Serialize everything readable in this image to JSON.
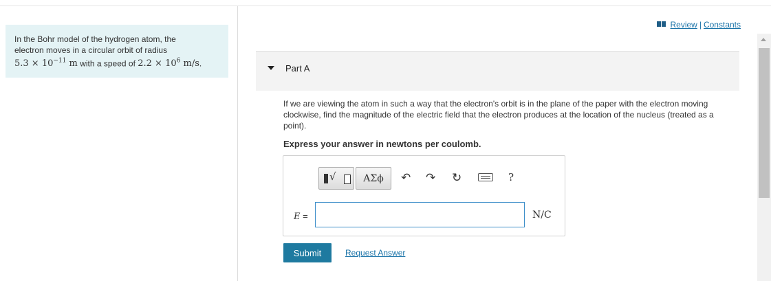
{
  "problem": {
    "line1": "In the Bohr model of the hydrogen atom, the",
    "line2": "electron moves in a circular orbit of radius",
    "radius": "5.3 × 10",
    "radius_exp": "−11",
    "radius_unit": "m",
    "mid_text": "with a speed of",
    "speed": "2.2 × 10",
    "speed_exp": "6",
    "speed_unit": "m/s",
    "end": "."
  },
  "links": {
    "review": "Review",
    "separator": "|",
    "constants": "Constants"
  },
  "part": {
    "title": "Part A",
    "question": "If we are viewing the atom in such a way that the electron's orbit is in the plane of the paper with the electron moving clockwise, find the magnitude of the electric field that the electron produces at the location of the nucleus (treated as a point).",
    "instruction": "Express your answer in newtons per coulomb."
  },
  "toolbar": {
    "templates_icon": "radical-template-icon",
    "greek_label": "ΑΣϕ",
    "undo_icon": "↶",
    "redo_icon": "↷",
    "reset_icon": "↻",
    "keyboard_icon": "keyboard-icon",
    "help_label": "?"
  },
  "answer": {
    "variable": "E",
    "equals": "=",
    "value": "",
    "unit": "N/C"
  },
  "buttons": {
    "submit": "Submit",
    "request_answer": "Request Answer"
  },
  "colors": {
    "link": "#1a73a8",
    "submit_bg": "#1e7aa0",
    "problem_bg": "#e4f3f5",
    "input_border": "#3d8ec9"
  }
}
